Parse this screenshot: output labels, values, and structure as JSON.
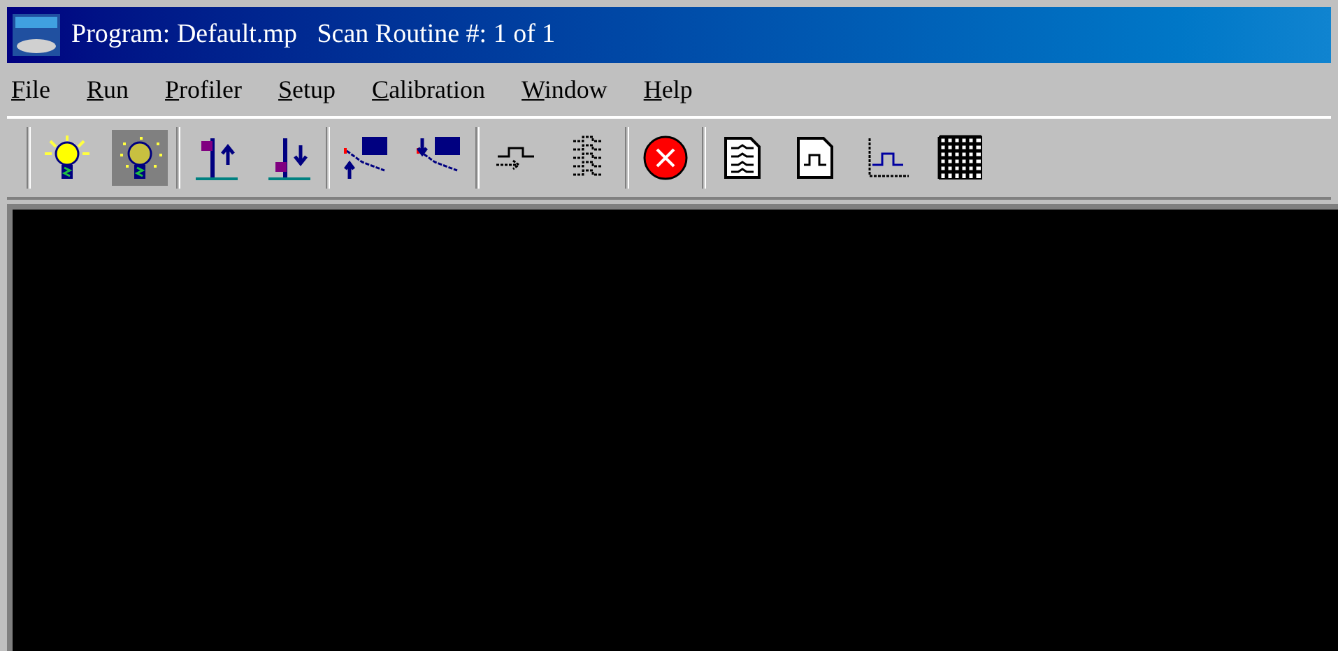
{
  "window": {
    "title": "Program: Default.mp   Scan Routine #: 1 of 1"
  },
  "menu": [
    {
      "label": "File"
    },
    {
      "label": "Run"
    },
    {
      "label": "Profiler"
    },
    {
      "label": "Setup"
    },
    {
      "label": "Calibration"
    },
    {
      "label": "Window"
    },
    {
      "label": "Help"
    }
  ],
  "toolbar": [
    [
      {
        "kind": "bulb",
        "pressed": false
      },
      {
        "kind": "bulb-dim",
        "pressed": true
      }
    ],
    [
      {
        "kind": "probe-up",
        "pressed": false
      },
      {
        "kind": "probe-down",
        "pressed": false
      }
    ],
    [
      {
        "kind": "scan-up",
        "pressed": false
      },
      {
        "kind": "scan-down",
        "pressed": false
      }
    ],
    [
      {
        "kind": "pulse",
        "pressed": false
      },
      {
        "kind": "pulses",
        "pressed": false
      }
    ],
    [
      {
        "kind": "stop",
        "pressed": false
      }
    ],
    [
      {
        "kind": "doc-lines",
        "pressed": false
      },
      {
        "kind": "doc-pulse",
        "pressed": false
      },
      {
        "kind": "plot",
        "pressed": false
      },
      {
        "kind": "grid",
        "pressed": false
      }
    ]
  ]
}
